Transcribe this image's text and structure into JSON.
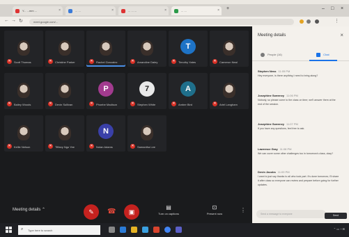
{
  "browser": {
    "tabs": [
      {
        "title": "Y... ...mm ...",
        "active": false
      },
      {
        "title": "... ...",
        "active": false
      },
      {
        "title": "... ... ...",
        "active": false
      },
      {
        "title": "... ...",
        "active": true
      }
    ],
    "url": "meet.google.com/..."
  },
  "participants": [
    {
      "name": "Scott Thomas",
      "type": "photo",
      "speaking": false
    },
    {
      "name": "Christine Parker",
      "type": "photo",
      "speaking": false
    },
    {
      "name": "Rachel Gonzalez",
      "type": "photo",
      "speaking": true
    },
    {
      "name": "Amandine Daley",
      "type": "photo",
      "speaking": false
    },
    {
      "name": "Timothy Yates",
      "type": "avatar",
      "letter": "T",
      "color": "#1e73c6",
      "speaking": false
    },
    {
      "name": "Cameron Neal",
      "type": "photo",
      "speaking": false
    },
    {
      "name": "Bailey Woods",
      "type": "photo",
      "speaking": false
    },
    {
      "name": "Devin Sullivan",
      "type": "photo",
      "speaking": false
    },
    {
      "name": "Phoebe Madison",
      "type": "avatar",
      "letter": "P",
      "color": "#a23b8f",
      "speaking": false
    },
    {
      "name": "Stephen White",
      "type": "avatar",
      "letter": "7",
      "color": "#e9e9e9",
      "speaking": false
    },
    {
      "name": "Amber Bird",
      "type": "avatar",
      "letter": "A",
      "color": "#1f6f8b",
      "speaking": false
    },
    {
      "name": "Ariel Langham",
      "type": "photo",
      "speaking": false
    },
    {
      "name": "Kellie Nelson",
      "type": "photo",
      "speaking": false
    },
    {
      "name": "Tiffany Ngo Yee",
      "type": "photo",
      "speaking": false
    },
    {
      "name": "Nolan Adams",
      "type": "avatar",
      "letter": "N",
      "color": "#3a40a8",
      "speaking": false
    },
    {
      "name": "Samantha Lee",
      "type": "photo",
      "speaking": false
    }
  ],
  "bottom_bar": {
    "meeting_details": "Meeting details",
    "captions_label": "Turn on captions",
    "present_label": "Present now"
  },
  "panel": {
    "title": "Meeting details",
    "tab_people": "People (16)",
    "tab_chat": "Chat",
    "messages": [
      {
        "author": "Stephen Ness",
        "time": "11:05 PM",
        "body": "Hey everyone, is there anything I need to bring along?"
      },
      {
        "author": "Josephine Sweeney",
        "time": "11:06 PM",
        "body": "Nobody, so please come to the class on time; we'll answer them at the end of the session."
      },
      {
        "author": "Josephine Sweeney",
        "time": "11:07 PM",
        "body": "If you have any questions, feel free to ask."
      },
      {
        "author": "Lawrence Gray",
        "time": "11:08 PM",
        "body": "We can cover some other challenges too in tomorrow's class, okay?"
      },
      {
        "author": "Devin Jacobs",
        "time": "11:09 PM",
        "body": "I want to just say thanks to all who took part. It's done tomorrow; I'll share it after class so everyone can review and prepare before going for further updates."
      }
    ],
    "compose_placeholder": "Send a message to everyone",
    "send_label": "Send"
  },
  "taskbar": {
    "search_placeholder": "Type here to search"
  },
  "colors": {
    "meet_bg": "#1a1b1d",
    "end_call": "#c5221f",
    "accent": "#1a73e8"
  }
}
